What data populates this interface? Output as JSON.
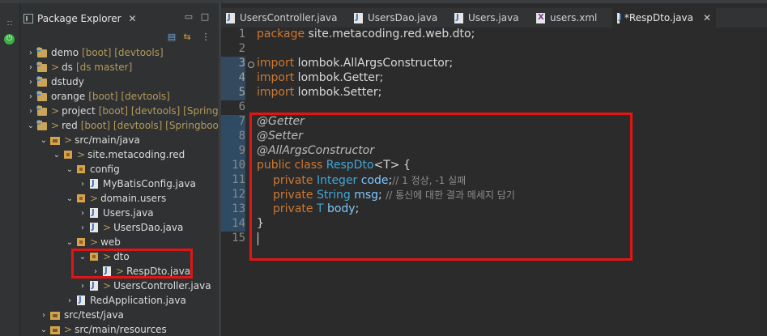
{
  "explorer": {
    "title": "Package Explorer",
    "close": "✕",
    "items": [
      {
        "indent": 0,
        "chev": ">",
        "icon": "proj",
        "label": "demo",
        "dec": "[boot] [devtools]"
      },
      {
        "indent": 0,
        "chev": ">",
        "icon": "proj",
        "gt": ">",
        "label": "ds",
        "dec": "[ds master]"
      },
      {
        "indent": 0,
        "chev": ">",
        "icon": "proj",
        "label": "dstudy",
        "dec": ""
      },
      {
        "indent": 0,
        "chev": ">",
        "icon": "proj",
        "label": "orange",
        "dec": "[boot] [devtools]"
      },
      {
        "indent": 0,
        "chev": ">",
        "icon": "proj",
        "gt": ">",
        "label": "project",
        "dec": "[boot] [devtools] [Springboo"
      },
      {
        "indent": 0,
        "chev": "v",
        "icon": "proj",
        "gt": ">",
        "label": "red",
        "dec": "[boot] [devtools] [Springboot-M"
      },
      {
        "indent": 1,
        "chev": "v",
        "icon": "srcf",
        "gt": ">",
        "label": "src/main/java",
        "dec": ""
      },
      {
        "indent": 2,
        "chev": "v",
        "icon": "pkg",
        "gt": ">",
        "label": "site.metacoding.red",
        "dec": ""
      },
      {
        "indent": 3,
        "chev": "v",
        "icon": "pkg",
        "label": "config",
        "dec": ""
      },
      {
        "indent": 4,
        "chev": ">",
        "icon": "jfile",
        "label": "MyBatisConfig.java",
        "dec": ""
      },
      {
        "indent": 3,
        "chev": "v",
        "icon": "pkg",
        "gt": ">",
        "label": "domain.users",
        "dec": ""
      },
      {
        "indent": 4,
        "chev": ">",
        "icon": "jfile",
        "label": "Users.java",
        "dec": ""
      },
      {
        "indent": 4,
        "chev": ">",
        "icon": "jfile",
        "gt": ">",
        "label": "UsersDao.java",
        "dec": ""
      },
      {
        "indent": 3,
        "chev": "v",
        "icon": "pkg",
        "gt": ">",
        "label": "web",
        "dec": ""
      },
      {
        "indent": 4,
        "chev": "v",
        "icon": "pkg",
        "gt": ">",
        "label": "dto",
        "dec": ""
      },
      {
        "indent": 5,
        "chev": ">",
        "icon": "jfile",
        "gt": ">",
        "label": "RespDto.java",
        "dec": ""
      },
      {
        "indent": 4,
        "chev": ">",
        "icon": "jfile",
        "gt": ">",
        "label": "UsersController.java",
        "dec": ""
      },
      {
        "indent": 3,
        "chev": ">",
        "icon": "jfile",
        "label": "RedApplication.java",
        "dec": ""
      },
      {
        "indent": 1,
        "chev": ">",
        "icon": "srcf",
        "label": "src/test/java",
        "dec": ""
      },
      {
        "indent": 1,
        "chev": "v",
        "icon": "srcf",
        "gt": ">",
        "label": "src/main/resources",
        "dec": ""
      }
    ]
  },
  "editor": {
    "tabs": [
      {
        "label": "UsersController.java",
        "type": "java",
        "active": false
      },
      {
        "label": "UsersDao.java",
        "type": "java",
        "active": false
      },
      {
        "label": "Users.java",
        "type": "java",
        "active": false
      },
      {
        "label": "users.xml",
        "type": "xml",
        "active": false
      },
      {
        "label": "*RespDto.java",
        "type": "java",
        "active": true
      }
    ],
    "tab_close": "✕",
    "line_numbers": [
      "1",
      "2",
      "3",
      "4",
      "5",
      "6",
      "7",
      "8",
      "9",
      "10",
      "11",
      "12",
      "13",
      "14",
      "15"
    ],
    "code": {
      "l1": {
        "kw": "package",
        "rest": " site.metacoding.red.web.dto;"
      },
      "l3": {
        "kw": "import",
        "rest": " lombok.AllArgsConstructor;"
      },
      "l4": {
        "kw": "import",
        "rest": " lombok.Getter;"
      },
      "l5": {
        "kw": "import",
        "rest": " lombok.Setter;"
      },
      "l7": "@Getter",
      "l8": "@Setter",
      "l9": "@AllArgsConstructor",
      "l10": {
        "kw": "public class",
        "name": "RespDto",
        "rest": "<T> {"
      },
      "l11": {
        "kw": "private",
        "type": "Integer",
        "field": "code",
        "punct": ";",
        "comment": "// 1 정상, -1 실패"
      },
      "l12": {
        "kw": "private",
        "type": "String",
        "field": "msg",
        "punct": ";",
        "comment": "// 통신에 대한 결과 메세지 담기"
      },
      "l13": {
        "kw": "private",
        "type": "T",
        "field": "body",
        "punct": ";"
      },
      "l14": "}"
    }
  },
  "colors": {
    "highlight": "#e21515",
    "keyword": "#cc7832",
    "type": "#43a6d6"
  }
}
